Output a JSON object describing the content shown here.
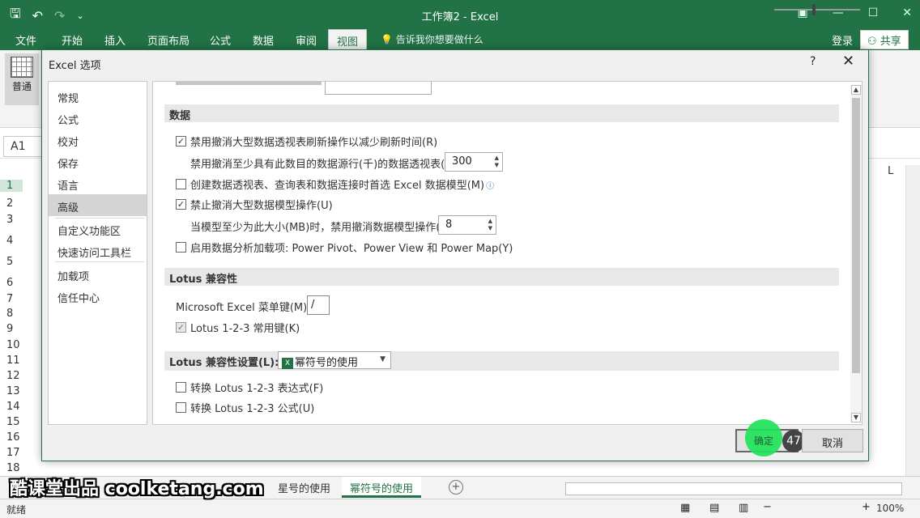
{
  "window": {
    "title": "工作簿2 - Excel",
    "login": "登录",
    "share": "共享",
    "tell_me": "告诉我你想要做什么"
  },
  "ribbon_tabs": [
    "文件",
    "开始",
    "插入",
    "页面布局",
    "公式",
    "数据",
    "审阅",
    "视图"
  ],
  "active_ribbon_tab": "视图",
  "ribbon": {
    "normal_view_label": "普通"
  },
  "formula_bar": {
    "name_box": "A1"
  },
  "sheet": {
    "rows": [
      "1",
      "2",
      "3",
      "4",
      "5",
      "6",
      "7",
      "8",
      "9",
      "10",
      "11",
      "12",
      "13",
      "14",
      "15",
      "16",
      "17",
      "18"
    ],
    "visible_column": "L",
    "tabs": [
      "星号的使用",
      "幂符号的使用"
    ],
    "active_tab": "幂符号的使用",
    "add_sheet": "+"
  },
  "status": {
    "ready": "就绪",
    "zoom": "100%"
  },
  "watermark": "酷课堂出品 coolketang.com",
  "dialog": {
    "title": "Excel 选项",
    "help": "?",
    "close": "✕",
    "nav": [
      "常规",
      "公式",
      "校对",
      "保存",
      "语言",
      "高级",
      "自定义功能区",
      "快速访问工具栏",
      "加载项",
      "信任中心"
    ],
    "nav_selected": "高级",
    "data_section": {
      "header": "数据",
      "opt1": "禁用撤消大型数据透视表刷新操作以减少刷新时间(R)",
      "opt1_checked": true,
      "opt1_sub_label": "禁用撤消至少具有此数目的数据源行(千)的数据透视表(N):",
      "opt1_sub_value": "300",
      "opt2": "创建数据透视表、查询表和数据连接时首选 Excel 数据模型(M)",
      "opt2_checked": false,
      "opt3": "禁止撤消大型数据模型操作(U)",
      "opt3_checked": true,
      "opt3_sub_label": "当模型至少为此大小(MB)时，禁用撤消数据模型操作(L):",
      "opt3_sub_value": "8",
      "opt4": "启用数据分析加载项: Power Pivot、Power View 和 Power Map(Y)",
      "opt4_checked": false
    },
    "lotus_section": {
      "header": "Lotus 兼容性",
      "menu_key_label": "Microsoft Excel 菜单键(M):",
      "menu_key_value": "/",
      "nav_keys": "Lotus 1-2-3 常用键(K)",
      "nav_keys_checked": true
    },
    "lotus_settings": {
      "header": "Lotus 兼容性设置(L):",
      "sheet_select": "幂符号的使用",
      "opt1": "转换 Lotus 1-2-3 表达式(F)",
      "opt1_checked": false,
      "opt2": "转换 Lotus 1-2-3 公式(U)",
      "opt2_checked": false
    },
    "ok": "确定",
    "cancel": "取消",
    "step_badge": "47"
  },
  "colors": {
    "excel_green": "#217346",
    "highlight_green": "#1fe35a"
  }
}
